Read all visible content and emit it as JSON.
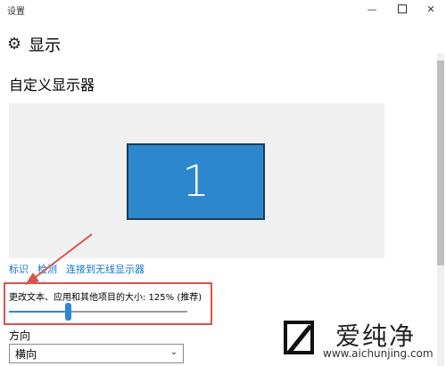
{
  "window": {
    "title": "设置",
    "minimize": "—",
    "close": "✕"
  },
  "header": {
    "title": "显示",
    "icon": "gear-icon"
  },
  "section": {
    "title": "自定义显示器"
  },
  "preview": {
    "monitor_number": "1",
    "monitor_color": "#2d87cc"
  },
  "links": [
    {
      "label": "标识"
    },
    {
      "label": "检测"
    },
    {
      "label": "连接到无线显示器"
    }
  ],
  "scale": {
    "label": "更改文本、应用和其他项目的大小: 125% (推荐)",
    "value_fraction": 0.33,
    "accent": "#2d87cc"
  },
  "orientation": {
    "label": "方向",
    "selected": "横向"
  },
  "watermark": {
    "brand": "爱纯净",
    "url": "www.aichunjing.com"
  }
}
